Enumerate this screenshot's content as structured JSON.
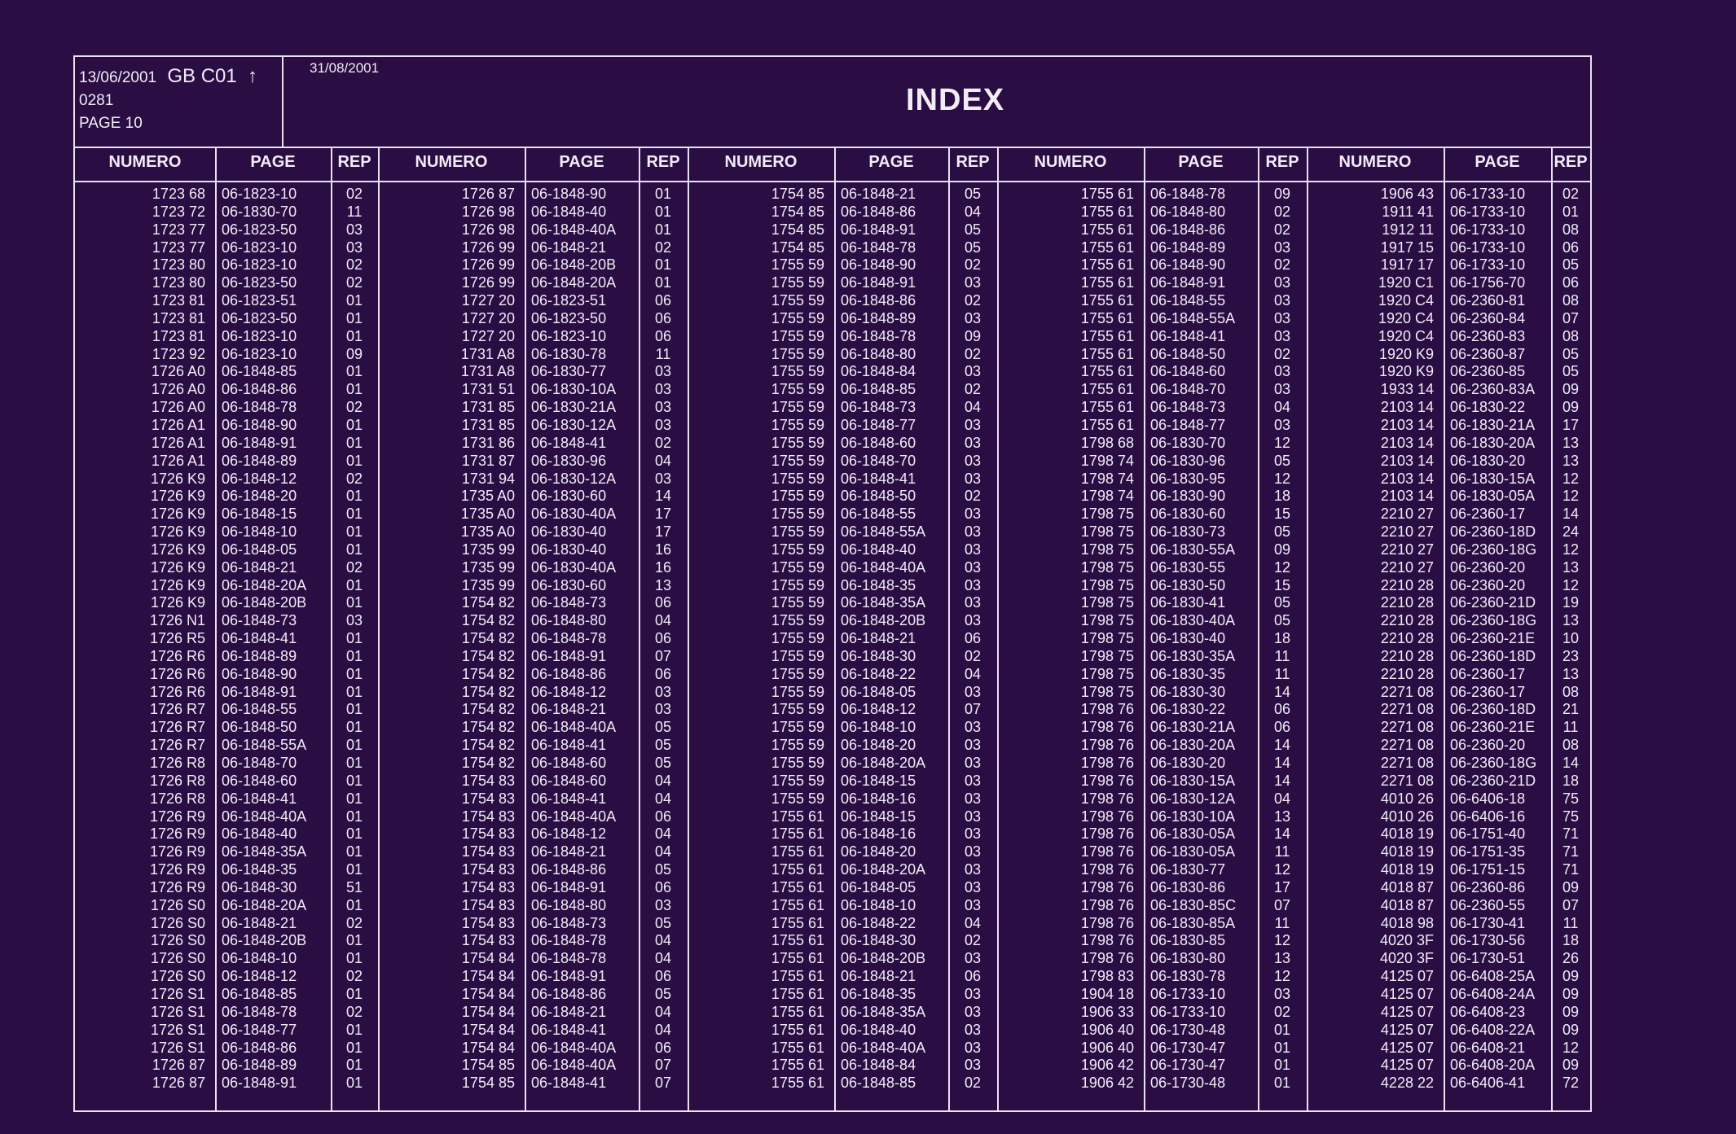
{
  "header": {
    "date_left": "13/06/2001",
    "code": "GB  C01",
    "arrow": "↑",
    "ref": "0281",
    "page": "PAGE  10",
    "date_right": "31/08/2001",
    "title": "INDEX"
  },
  "columns": {
    "numero": "NUMERO",
    "page": "PAGE",
    "rep": "REP"
  },
  "groups": [
    [
      [
        "1723 68",
        "06-1823-10",
        "02"
      ],
      [
        "1723 72",
        "06-1830-70",
        "11"
      ],
      [
        "1723 77",
        "06-1823-50",
        "03"
      ],
      [
        "1723 77",
        "06-1823-10",
        "03"
      ],
      [
        "1723 80",
        "06-1823-10",
        "02"
      ],
      [
        "1723 80",
        "06-1823-50",
        "02"
      ],
      [
        "1723 81",
        "06-1823-51",
        "01"
      ],
      [
        "1723 81",
        "06-1823-50",
        "01"
      ],
      [
        "1723 81",
        "06-1823-10",
        "01"
      ],
      [
        "1723 92",
        "06-1823-10",
        "09"
      ],
      [
        "1726 A0",
        "06-1848-85",
        "01"
      ],
      [
        "1726 A0",
        "06-1848-86",
        "01"
      ],
      [
        "1726 A0",
        "06-1848-78",
        "02"
      ],
      [
        "1726 A1",
        "06-1848-90",
        "01"
      ],
      [
        "1726 A1",
        "06-1848-91",
        "01"
      ],
      [
        "1726 A1",
        "06-1848-89",
        "01"
      ],
      [
        "1726 K9",
        "06-1848-12",
        "02"
      ],
      [
        "1726 K9",
        "06-1848-20",
        "01"
      ],
      [
        "1726 K9",
        "06-1848-15",
        "01"
      ],
      [
        "1726 K9",
        "06-1848-10",
        "01"
      ],
      [
        "1726 K9",
        "06-1848-05",
        "01"
      ],
      [
        "1726 K9",
        "06-1848-21",
        "02"
      ],
      [
        "1726 K9",
        "06-1848-20A",
        "01"
      ],
      [
        "1726 K9",
        "06-1848-20B",
        "01"
      ],
      [
        "1726 N1",
        "06-1848-73",
        "03"
      ],
      [
        "1726 R5",
        "06-1848-41",
        "01"
      ],
      [
        "1726 R6",
        "06-1848-89",
        "01"
      ],
      [
        "1726 R6",
        "06-1848-90",
        "01"
      ],
      [
        "1726 R6",
        "06-1848-91",
        "01"
      ],
      [
        "1726 R7",
        "06-1848-55",
        "01"
      ],
      [
        "1726 R7",
        "06-1848-50",
        "01"
      ],
      [
        "1726 R7",
        "06-1848-55A",
        "01"
      ],
      [
        "1726 R8",
        "06-1848-70",
        "01"
      ],
      [
        "1726 R8",
        "06-1848-60",
        "01"
      ],
      [
        "1726 R8",
        "06-1848-41",
        "01"
      ],
      [
        "1726 R9",
        "06-1848-40A",
        "01"
      ],
      [
        "1726 R9",
        "06-1848-40",
        "01"
      ],
      [
        "1726 R9",
        "06-1848-35A",
        "01"
      ],
      [
        "1726 R9",
        "06-1848-35",
        "01"
      ],
      [
        "1726 R9",
        "06-1848-30",
        "51"
      ],
      [
        "1726 S0",
        "06-1848-20A",
        "01"
      ],
      [
        "1726 S0",
        "06-1848-21",
        "02"
      ],
      [
        "1726 S0",
        "06-1848-20B",
        "01"
      ],
      [
        "1726 S0",
        "06-1848-10",
        "01"
      ],
      [
        "1726 S0",
        "06-1848-12",
        "02"
      ],
      [
        "1726 S1",
        "06-1848-85",
        "01"
      ],
      [
        "1726 S1",
        "06-1848-78",
        "02"
      ],
      [
        "1726 S1",
        "06-1848-77",
        "01"
      ],
      [
        "1726 S1",
        "06-1848-86",
        "01"
      ],
      [
        "1726 87",
        "06-1848-89",
        "01"
      ],
      [
        "1726 87",
        "06-1848-91",
        "01"
      ]
    ],
    [
      [
        "1726 87",
        "06-1848-90",
        "01"
      ],
      [
        "1726 98",
        "06-1848-40",
        "01"
      ],
      [
        "1726 98",
        "06-1848-40A",
        "01"
      ],
      [
        "1726 99",
        "06-1848-21",
        "02"
      ],
      [
        "1726 99",
        "06-1848-20B",
        "01"
      ],
      [
        "1726 99",
        "06-1848-20A",
        "01"
      ],
      [
        "1727 20",
        "06-1823-51",
        "06"
      ],
      [
        "1727 20",
        "06-1823-50",
        "06"
      ],
      [
        "1727 20",
        "06-1823-10",
        "06"
      ],
      [
        "1731 A8",
        "06-1830-78",
        "11"
      ],
      [
        "1731 A8",
        "06-1830-77",
        "03"
      ],
      [
        "1731 51",
        "06-1830-10A",
        "03"
      ],
      [
        "1731 85",
        "06-1830-21A",
        "03"
      ],
      [
        "1731 85",
        "06-1830-12A",
        "03"
      ],
      [
        "1731 86",
        "06-1848-41",
        "02"
      ],
      [
        "1731 87",
        "06-1830-96",
        "04"
      ],
      [
        "1731 94",
        "06-1830-12A",
        "03"
      ],
      [
        "1735 A0",
        "06-1830-60",
        "14"
      ],
      [
        "1735 A0",
        "06-1830-40A",
        "17"
      ],
      [
        "1735 A0",
        "06-1830-40",
        "17"
      ],
      [
        "1735 99",
        "06-1830-40",
        "16"
      ],
      [
        "1735 99",
        "06-1830-40A",
        "16"
      ],
      [
        "1735 99",
        "06-1830-60",
        "13"
      ],
      [
        "1754 82",
        "06-1848-73",
        "06"
      ],
      [
        "1754 82",
        "06-1848-80",
        "04"
      ],
      [
        "1754 82",
        "06-1848-78",
        "06"
      ],
      [
        "1754 82",
        "06-1848-91",
        "07"
      ],
      [
        "1754 82",
        "06-1848-86",
        "06"
      ],
      [
        "1754 82",
        "06-1848-12",
        "03"
      ],
      [
        "1754 82",
        "06-1848-21",
        "03"
      ],
      [
        "1754 82",
        "06-1848-40A",
        "05"
      ],
      [
        "1754 82",
        "06-1848-41",
        "05"
      ],
      [
        "1754 82",
        "06-1848-60",
        "05"
      ],
      [
        "1754 83",
        "06-1848-60",
        "04"
      ],
      [
        "1754 83",
        "06-1848-41",
        "04"
      ],
      [
        "1754 83",
        "06-1848-40A",
        "06"
      ],
      [
        "1754 83",
        "06-1848-12",
        "04"
      ],
      [
        "1754 83",
        "06-1848-21",
        "04"
      ],
      [
        "1754 83",
        "06-1848-86",
        "05"
      ],
      [
        "1754 83",
        "06-1848-91",
        "06"
      ],
      [
        "1754 83",
        "06-1848-80",
        "03"
      ],
      [
        "1754 83",
        "06-1848-73",
        "05"
      ],
      [
        "1754 83",
        "06-1848-78",
        "04"
      ],
      [
        "1754 84",
        "06-1848-78",
        "04"
      ],
      [
        "1754 84",
        "06-1848-91",
        "06"
      ],
      [
        "1754 84",
        "06-1848-86",
        "05"
      ],
      [
        "1754 84",
        "06-1848-21",
        "04"
      ],
      [
        "1754 84",
        "06-1848-41",
        "04"
      ],
      [
        "1754 84",
        "06-1848-40A",
        "06"
      ],
      [
        "1754 85",
        "06-1848-40A",
        "07"
      ],
      [
        "1754 85",
        "06-1848-41",
        "07"
      ]
    ],
    [
      [
        "1754 85",
        "06-1848-21",
        "05"
      ],
      [
        "1754 85",
        "06-1848-86",
        "04"
      ],
      [
        "1754 85",
        "06-1848-91",
        "05"
      ],
      [
        "1754 85",
        "06-1848-78",
        "05"
      ],
      [
        "1755 59",
        "06-1848-90",
        "02"
      ],
      [
        "1755 59",
        "06-1848-91",
        "03"
      ],
      [
        "1755 59",
        "06-1848-86",
        "02"
      ],
      [
        "1755 59",
        "06-1848-89",
        "03"
      ],
      [
        "1755 59",
        "06-1848-78",
        "09"
      ],
      [
        "1755 59",
        "06-1848-80",
        "02"
      ],
      [
        "1755 59",
        "06-1848-84",
        "03"
      ],
      [
        "1755 59",
        "06-1848-85",
        "02"
      ],
      [
        "1755 59",
        "06-1848-73",
        "04"
      ],
      [
        "1755 59",
        "06-1848-77",
        "03"
      ],
      [
        "1755 59",
        "06-1848-60",
        "03"
      ],
      [
        "1755 59",
        "06-1848-70",
        "03"
      ],
      [
        "1755 59",
        "06-1848-41",
        "03"
      ],
      [
        "1755 59",
        "06-1848-50",
        "02"
      ],
      [
        "1755 59",
        "06-1848-55",
        "03"
      ],
      [
        "1755 59",
        "06-1848-55A",
        "03"
      ],
      [
        "1755 59",
        "06-1848-40",
        "03"
      ],
      [
        "1755 59",
        "06-1848-40A",
        "03"
      ],
      [
        "1755 59",
        "06-1848-35",
        "03"
      ],
      [
        "1755 59",
        "06-1848-35A",
        "03"
      ],
      [
        "1755 59",
        "06-1848-20B",
        "03"
      ],
      [
        "1755 59",
        "06-1848-21",
        "06"
      ],
      [
        "1755 59",
        "06-1848-30",
        "02"
      ],
      [
        "1755 59",
        "06-1848-22",
        "04"
      ],
      [
        "1755 59",
        "06-1848-05",
        "03"
      ],
      [
        "1755 59",
        "06-1848-12",
        "07"
      ],
      [
        "1755 59",
        "06-1848-10",
        "03"
      ],
      [
        "1755 59",
        "06-1848-20",
        "03"
      ],
      [
        "1755 59",
        "06-1848-20A",
        "03"
      ],
      [
        "1755 59",
        "06-1848-15",
        "03"
      ],
      [
        "1755 59",
        "06-1848-16",
        "03"
      ],
      [
        "1755 61",
        "06-1848-15",
        "03"
      ],
      [
        "1755 61",
        "06-1848-16",
        "03"
      ],
      [
        "1755 61",
        "06-1848-20",
        "03"
      ],
      [
        "1755 61",
        "06-1848-20A",
        "03"
      ],
      [
        "1755 61",
        "06-1848-05",
        "03"
      ],
      [
        "1755 61",
        "06-1848-10",
        "03"
      ],
      [
        "1755 61",
        "06-1848-22",
        "04"
      ],
      [
        "1755 61",
        "06-1848-30",
        "02"
      ],
      [
        "1755 61",
        "06-1848-20B",
        "03"
      ],
      [
        "1755 61",
        "06-1848-21",
        "06"
      ],
      [
        "1755 61",
        "06-1848-35",
        "03"
      ],
      [
        "1755 61",
        "06-1848-35A",
        "03"
      ],
      [
        "1755 61",
        "06-1848-40",
        "03"
      ],
      [
        "1755 61",
        "06-1848-40A",
        "03"
      ],
      [
        "1755 61",
        "06-1848-84",
        "03"
      ],
      [
        "1755 61",
        "06-1848-85",
        "02"
      ]
    ],
    [
      [
        "1755 61",
        "06-1848-78",
        "09"
      ],
      [
        "1755 61",
        "06-1848-80",
        "02"
      ],
      [
        "1755 61",
        "06-1848-86",
        "02"
      ],
      [
        "1755 61",
        "06-1848-89",
        "03"
      ],
      [
        "1755 61",
        "06-1848-90",
        "02"
      ],
      [
        "1755 61",
        "06-1848-91",
        "03"
      ],
      [
        "1755 61",
        "06-1848-55",
        "03"
      ],
      [
        "1755 61",
        "06-1848-55A",
        "03"
      ],
      [
        "1755 61",
        "06-1848-41",
        "03"
      ],
      [
        "1755 61",
        "06-1848-50",
        "02"
      ],
      [
        "1755 61",
        "06-1848-60",
        "03"
      ],
      [
        "1755 61",
        "06-1848-70",
        "03"
      ],
      [
        "1755 61",
        "06-1848-73",
        "04"
      ],
      [
        "1755 61",
        "06-1848-77",
        "03"
      ],
      [
        "1798 68",
        "06-1830-70",
        "12"
      ],
      [
        "1798 74",
        "06-1830-96",
        "05"
      ],
      [
        "1798 74",
        "06-1830-95",
        "12"
      ],
      [
        "1798 74",
        "06-1830-90",
        "18"
      ],
      [
        "1798 75",
        "06-1830-60",
        "15"
      ],
      [
        "1798 75",
        "06-1830-73",
        "05"
      ],
      [
        "1798 75",
        "06-1830-55A",
        "09"
      ],
      [
        "1798 75",
        "06-1830-55",
        "12"
      ],
      [
        "1798 75",
        "06-1830-50",
        "15"
      ],
      [
        "1798 75",
        "06-1830-41",
        "05"
      ],
      [
        "1798 75",
        "06-1830-40A",
        "05"
      ],
      [
        "1798 75",
        "06-1830-40",
        "18"
      ],
      [
        "1798 75",
        "06-1830-35A",
        "11"
      ],
      [
        "1798 75",
        "06-1830-35",
        "11"
      ],
      [
        "1798 75",
        "06-1830-30",
        "14"
      ],
      [
        "1798 76",
        "06-1830-22",
        "06"
      ],
      [
        "1798 76",
        "06-1830-21A",
        "06"
      ],
      [
        "1798 76",
        "06-1830-20A",
        "14"
      ],
      [
        "1798 76",
        "06-1830-20",
        "14"
      ],
      [
        "1798 76",
        "06-1830-15A",
        "14"
      ],
      [
        "1798 76",
        "06-1830-12A",
        "04"
      ],
      [
        "1798 76",
        "06-1830-10A",
        "13"
      ],
      [
        "1798 76",
        "06-1830-05A",
        "14"
      ],
      [
        "1798 76",
        "06-1830-05A",
        "11"
      ],
      [
        "1798 76",
        "06-1830-77",
        "12"
      ],
      [
        "1798 76",
        "06-1830-86",
        "17"
      ],
      [
        "1798 76",
        "06-1830-85C",
        "07"
      ],
      [
        "1798 76",
        "06-1830-85A",
        "11"
      ],
      [
        "1798 76",
        "06-1830-85",
        "12"
      ],
      [
        "1798 76",
        "06-1830-80",
        "13"
      ],
      [
        "1798 83",
        "06-1830-78",
        "12"
      ],
      [
        "1904 18",
        "06-1733-10",
        "03"
      ],
      [
        "1906 33",
        "06-1733-10",
        "02"
      ],
      [
        "1906 40",
        "06-1730-48",
        "01"
      ],
      [
        "1906 40",
        "06-1730-47",
        "01"
      ],
      [
        "1906 42",
        "06-1730-47",
        "01"
      ],
      [
        "1906 42",
        "06-1730-48",
        "01"
      ]
    ],
    [
      [
        "1906 43",
        "06-1733-10",
        "02"
      ],
      [
        "1911 41",
        "06-1733-10",
        "01"
      ],
      [
        "1912 11",
        "06-1733-10",
        "08"
      ],
      [
        "1917 15",
        "06-1733-10",
        "06"
      ],
      [
        "1917 17",
        "06-1733-10",
        "05"
      ],
      [
        "1920 C1",
        "06-1756-70",
        "06"
      ],
      [
        "1920 C4",
        "06-2360-81",
        "08"
      ],
      [
        "1920 C4",
        "06-2360-84",
        "07"
      ],
      [
        "1920 C4",
        "06-2360-83",
        "08"
      ],
      [
        "1920 K9",
        "06-2360-87",
        "05"
      ],
      [
        "1920 K9",
        "06-2360-85",
        "05"
      ],
      [
        "1933 14",
        "06-2360-83A",
        "09"
      ],
      [
        "2103 14",
        "06-1830-22",
        "09"
      ],
      [
        "2103 14",
        "06-1830-21A",
        "17"
      ],
      [
        "2103 14",
        "06-1830-20A",
        "13"
      ],
      [
        "2103 14",
        "06-1830-20",
        "13"
      ],
      [
        "2103 14",
        "06-1830-15A",
        "12"
      ],
      [
        "2103 14",
        "06-1830-05A",
        "12"
      ],
      [
        "2210 27",
        "06-2360-17",
        "14"
      ],
      [
        "2210 27",
        "06-2360-18D",
        "24"
      ],
      [
        "2210 27",
        "06-2360-18G",
        "12"
      ],
      [
        "2210 27",
        "06-2360-20",
        "13"
      ],
      [
        "2210 28",
        "06-2360-20",
        "12"
      ],
      [
        "2210 28",
        "06-2360-21D",
        "19"
      ],
      [
        "2210 28",
        "06-2360-18G",
        "13"
      ],
      [
        "2210 28",
        "06-2360-21E",
        "10"
      ],
      [
        "2210 28",
        "06-2360-18D",
        "23"
      ],
      [
        "2210 28",
        "06-2360-17",
        "13"
      ],
      [
        "2271 08",
        "06-2360-17",
        "08"
      ],
      [
        "2271 08",
        "06-2360-18D",
        "21"
      ],
      [
        "2271 08",
        "06-2360-21E",
        "11"
      ],
      [
        "2271 08",
        "06-2360-20",
        "08"
      ],
      [
        "2271 08",
        "06-2360-18G",
        "14"
      ],
      [
        "2271 08",
        "06-2360-21D",
        "18"
      ],
      [
        "4010 26",
        "06-6406-18",
        "75"
      ],
      [
        "4010 26",
        "06-6406-16",
        "75"
      ],
      [
        "4018 19",
        "06-1751-40",
        "71"
      ],
      [
        "4018 19",
        "06-1751-35",
        "71"
      ],
      [
        "4018 19",
        "06-1751-15",
        "71"
      ],
      [
        "4018 87",
        "06-2360-86",
        "09"
      ],
      [
        "4018 87",
        "06-2360-55",
        "07"
      ],
      [
        "4018 98",
        "06-1730-41",
        "11"
      ],
      [
        "4020 3F",
        "06-1730-56",
        "18"
      ],
      [
        "4020 3F",
        "06-1730-51",
        "26"
      ],
      [
        "4125 07",
        "06-6408-25A",
        "09"
      ],
      [
        "4125 07",
        "06-6408-24A",
        "09"
      ],
      [
        "4125 07",
        "06-6408-23",
        "09"
      ],
      [
        "4125 07",
        "06-6408-22A",
        "09"
      ],
      [
        "4125 07",
        "06-6408-21",
        "12"
      ],
      [
        "4125 07",
        "06-6408-20A",
        "09"
      ],
      [
        "4228 22",
        "06-6406-41",
        "72"
      ]
    ]
  ]
}
